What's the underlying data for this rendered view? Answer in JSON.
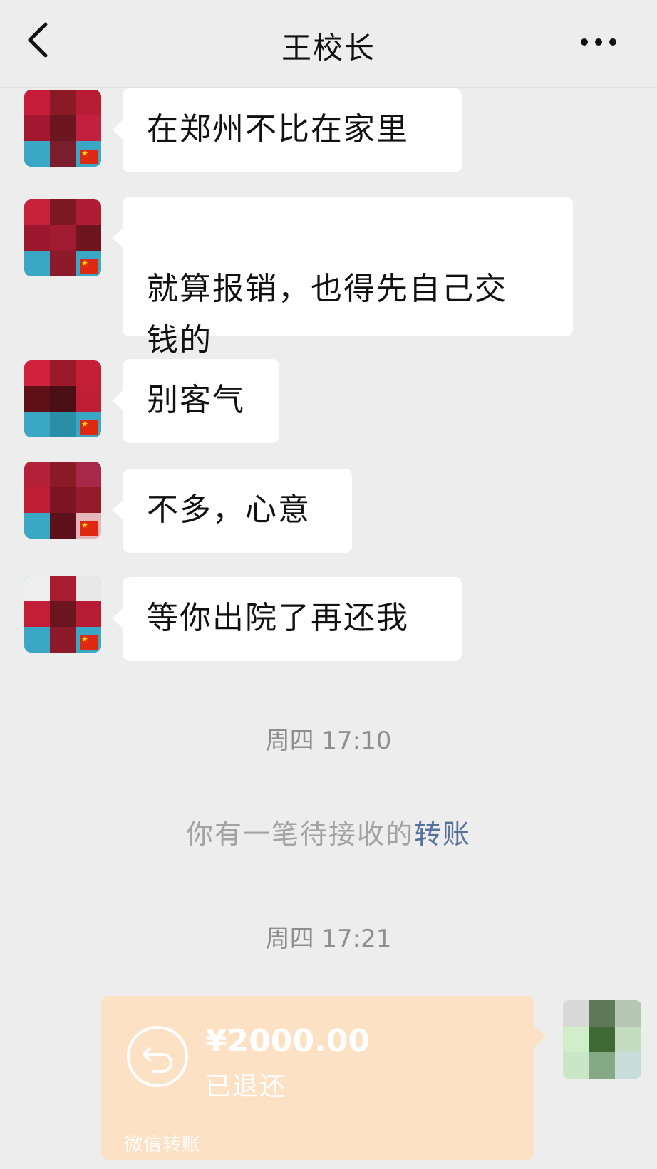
{
  "header": {
    "title": "王校长"
  },
  "messages": [
    {
      "text": "在郑州不比在家里"
    },
    {
      "text": "就算报销，也得先自己交\n钱的"
    },
    {
      "text": "别客气"
    },
    {
      "text": "不多，心意"
    },
    {
      "text": "等你出院了再还我"
    }
  ],
  "timestamps": [
    "周四 17:10",
    "周四 17:21"
  ],
  "notice": {
    "prefix": "你有一笔待接收的",
    "link": "转账"
  },
  "transfer": {
    "amount": "¥2000.00",
    "status": "已退还",
    "footer": "微信转账"
  },
  "colors": {
    "background": "#ededed",
    "transfer_card": "#fde1c4",
    "link": "#57729a"
  }
}
